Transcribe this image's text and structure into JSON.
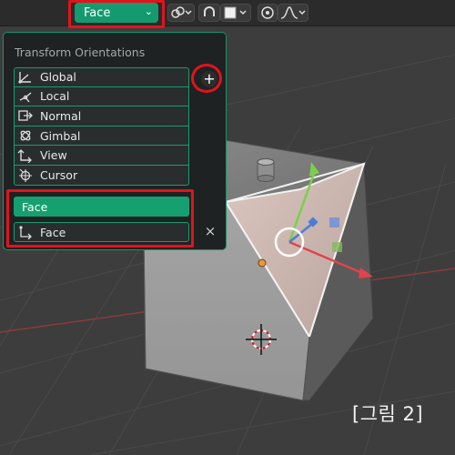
{
  "toolbar": {
    "orientation_value": "Face",
    "chevron": "⌄"
  },
  "panel": {
    "title": "Transform Orientations",
    "items": [
      {
        "label": "Global",
        "icon": "global-orientation-icon"
      },
      {
        "label": "Local",
        "icon": "local-orientation-icon"
      },
      {
        "label": "Normal",
        "icon": "normal-orientation-icon"
      },
      {
        "label": "Gimbal",
        "icon": "gimbal-orientation-icon"
      },
      {
        "label": "View",
        "icon": "view-orientation-icon"
      },
      {
        "label": "Cursor",
        "icon": "cursor-orientation-icon"
      }
    ],
    "add_symbol": "+",
    "custom_selected": "Face",
    "custom_name": "Face",
    "close_symbol": "×"
  },
  "caption": "[그림 2]",
  "colors": {
    "accent": "#16a070",
    "highlight": "#e0141d",
    "panel_bg": "#1e2222",
    "viewport_bg": "#3d3d3d"
  }
}
